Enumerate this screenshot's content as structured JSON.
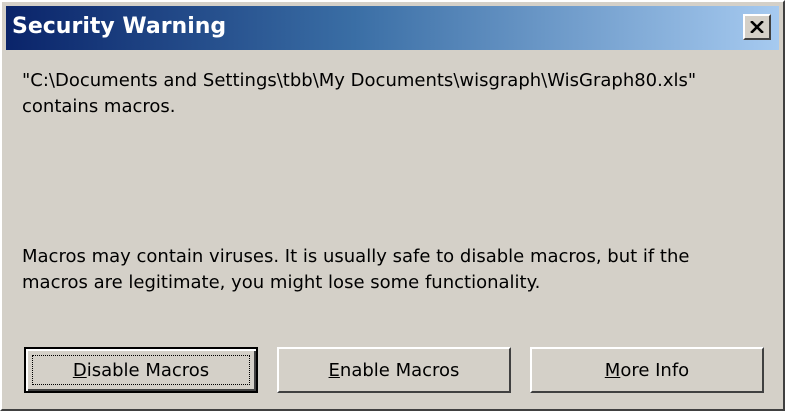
{
  "window": {
    "title": "Security Warning",
    "close_icon": "close-icon"
  },
  "message": {
    "path_line1": "\"C:\\Documents and Settings\\tbb\\My Documents\\wisgraph\\WisGraph80.xls\"",
    "path_line2": "contains macros.",
    "warning_line1": "Macros may contain viruses. It is usually safe to disable macros, but if the",
    "warning_line2": "macros are legitimate, you might lose some functionality."
  },
  "buttons": {
    "disable": {
      "accel": "D",
      "rest": "isable Macros"
    },
    "enable": {
      "accel": "E",
      "rest": "nable Macros"
    },
    "more": {
      "accel": "M",
      "rest": "ore Info"
    }
  },
  "colors": {
    "face": "#d4d0c8",
    "title_start": "#0a246a",
    "title_end": "#a6caf0"
  }
}
